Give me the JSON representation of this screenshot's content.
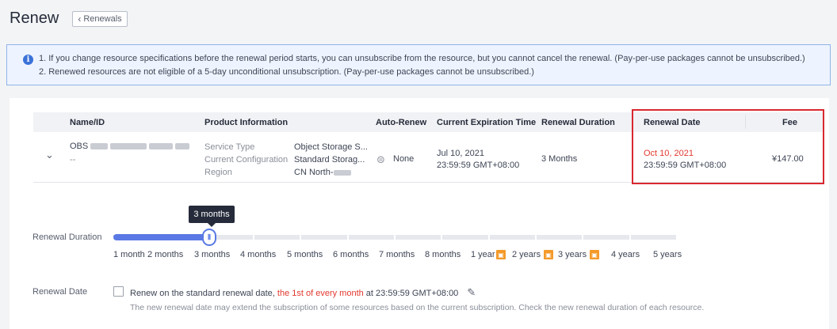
{
  "header": {
    "title": "Renew",
    "back_label": "Renewals"
  },
  "banner": {
    "note1": "1. If you change resource specifications before the renewal period starts, you can unsubscribe from the resource, but you cannot cancel the renewal. (Pay-per-use packages cannot be unsubscribed.)",
    "note2": "2. Renewed resources are not eligible of a 5-day unconditional unsubscription. (Pay-per-use packages cannot be unsubscribed.)"
  },
  "table": {
    "headers": {
      "name": "Name/ID",
      "product": "Product Information",
      "auto_renew": "Auto-Renew",
      "expiration": "Current Expiration Time",
      "duration": "Renewal Duration",
      "renewal_date": "Renewal Date",
      "fee": "Fee"
    },
    "row": {
      "name_prefix": "OBS",
      "id": "--",
      "info_labels": [
        "Service Type",
        "Current Configuration",
        "Region"
      ],
      "info_values": [
        "Object Storage S...",
        "Standard Storag...",
        "CN North-"
      ],
      "auto_renew": "None",
      "expiration_date": "Jul 10, 2021",
      "expiration_time": "23:59:59 GMT+08:00",
      "duration": "3 Months",
      "renewal_date": "Oct 10, 2021",
      "renewal_time": "23:59:59 GMT+08:00",
      "fee": "¥147.00"
    }
  },
  "slider": {
    "label": "Renewal Duration",
    "tooltip": "3 months",
    "selected_fraction": 0.17,
    "options": [
      "1 month",
      "2 months",
      "3 months",
      "4 months",
      "5 months",
      "6 months",
      "7 months",
      "8 months",
      "1 year",
      "2 years",
      "3 years",
      "4 years",
      "5 years"
    ]
  },
  "renewal_date": {
    "label": "Renewal Date",
    "text_before": "Renew on the standard renewal date, ",
    "text_highlight": "the 1st of every month",
    "text_after": " at 23:59:59 GMT+08:00",
    "note": "The new renewal date may extend the subscription of some resources based on the current subscription. Check the new renewal duration of each resource."
  },
  "colors": {
    "accent": "#5a79e4",
    "danger": "#e2392f",
    "badge": "#f49a2a"
  }
}
